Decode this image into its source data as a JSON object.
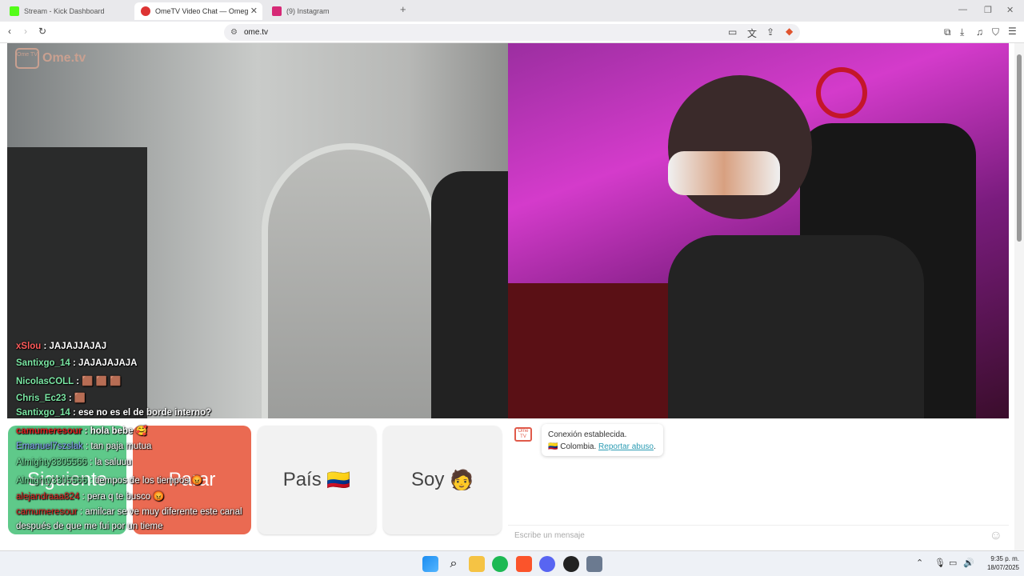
{
  "tabs": [
    {
      "title": "Stream - Kick Dashboard",
      "favicon_color": "#53fc18"
    },
    {
      "title": "OmeTV Video Chat — Omeg",
      "favicon_color": "#d33"
    },
    {
      "title": "(9) Instagram",
      "favicon_color": "#d62976"
    }
  ],
  "toolbar": {
    "url": "ome.tv"
  },
  "logo": {
    "text": "Ome.tv",
    "badge": "Ome TV"
  },
  "overlay_left": [
    {
      "user": "xSlou",
      "msg": ": JAJAJJAJAJ"
    },
    {
      "user": "Santixgo_14",
      "msg": ": JAJAJAJAJA"
    },
    {
      "user": "NicolasCOLL",
      "msg": ": 🟫 🟫 🟫"
    },
    {
      "user": "Chris_Ec23",
      "msg": ": 🟫"
    },
    {
      "user": "Santixgo_14",
      "msg": ": ese no es el de borde interno?"
    }
  ],
  "overlay_bottom": [
    {
      "user": "camumeresour",
      "msg": ": hola bebe 🥰"
    },
    {
      "user": "Emanuel7szslak",
      "msg": ": tan paja mutua"
    },
    {
      "user": "Almighty3305566",
      "msg": ": la saluuu"
    },
    {
      "user": "Almighty3305566",
      "msg": ": tiempos de los tiempos 😡"
    },
    {
      "user": "alejandraaa824",
      "msg": ": pera q te busco 😡"
    },
    {
      "user": "camumeresour",
      "msg": ": amilcar se ve muy diferente este canal"
    },
    {
      "user": "",
      "msg": "después de que me fui por un tieme"
    }
  ],
  "buttons": {
    "next": "Siguiente",
    "stop": "Parar",
    "country": "País",
    "country_flag": "🇨🇴",
    "soy": "Soy",
    "soy_emoji": "🧑"
  },
  "chat": {
    "connected": "Conexión establecida.",
    "country": "Colombia.",
    "report": "Reportar abuso",
    "placeholder": "Escribe un mensaje"
  },
  "taskbar": {
    "time": "9:35 p. m.",
    "date": "18/07/2025"
  },
  "colors": {
    "next_bg": "#5fc98a",
    "stop_bg": "#ea6a52",
    "tile_bg": "#f2f2f2",
    "accent": "#2a9bb3"
  }
}
